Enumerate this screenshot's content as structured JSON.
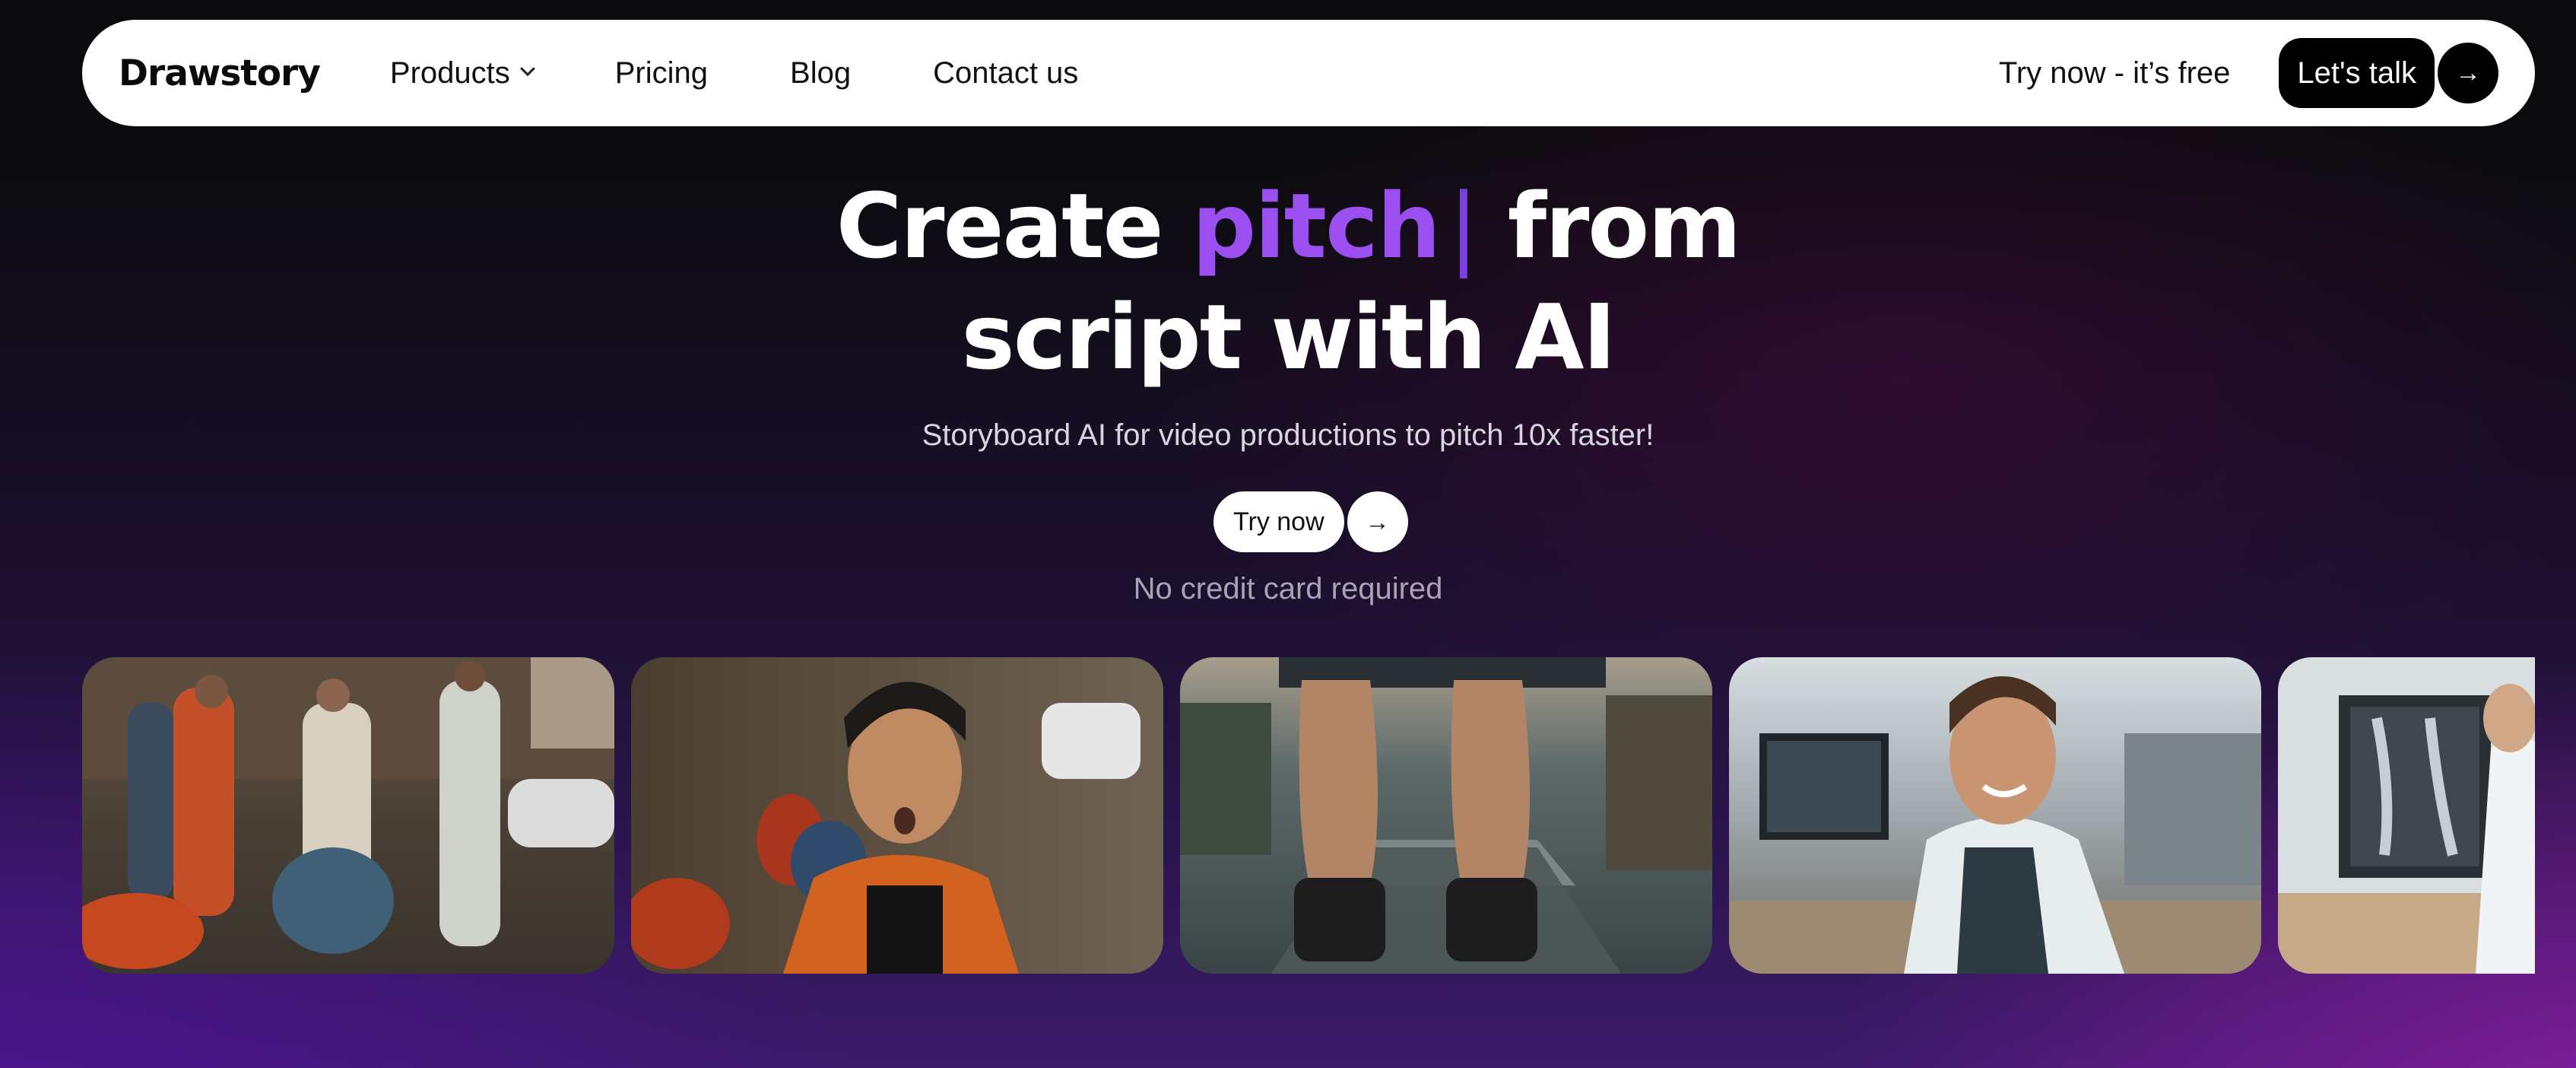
{
  "nav": {
    "logo": "Drawstory",
    "links": [
      {
        "label": "Products",
        "has_dropdown": true
      },
      {
        "label": "Pricing"
      },
      {
        "label": "Blog"
      },
      {
        "label": "Contact us"
      }
    ],
    "try_free": "Try now - it’s free",
    "talk_label": "Let's talk",
    "talk_arrow_icon": "arrow-right-icon"
  },
  "hero": {
    "title_prefix": "Create",
    "title_accent": "pitch",
    "title_cursor": "|",
    "title_suffix": "from",
    "title_line2": "script with AI",
    "subtitle": "Storyboard AI for video productions to pitch 10x faster!",
    "cta_label": "Try now",
    "cta_arrow_icon": "arrow-right-icon",
    "note": "No credit card required",
    "accent_color": "#9b4ff0"
  },
  "gallery": {
    "images": [
      {
        "description": "people arguing beside scooters on a street"
      },
      {
        "description": "shocked man in orange jacket"
      },
      {
        "description": "legs in shorts above stone steps"
      },
      {
        "description": "smiling man with headset at office desk"
      },
      {
        "description": "doctor pointing at x-ray"
      }
    ]
  }
}
